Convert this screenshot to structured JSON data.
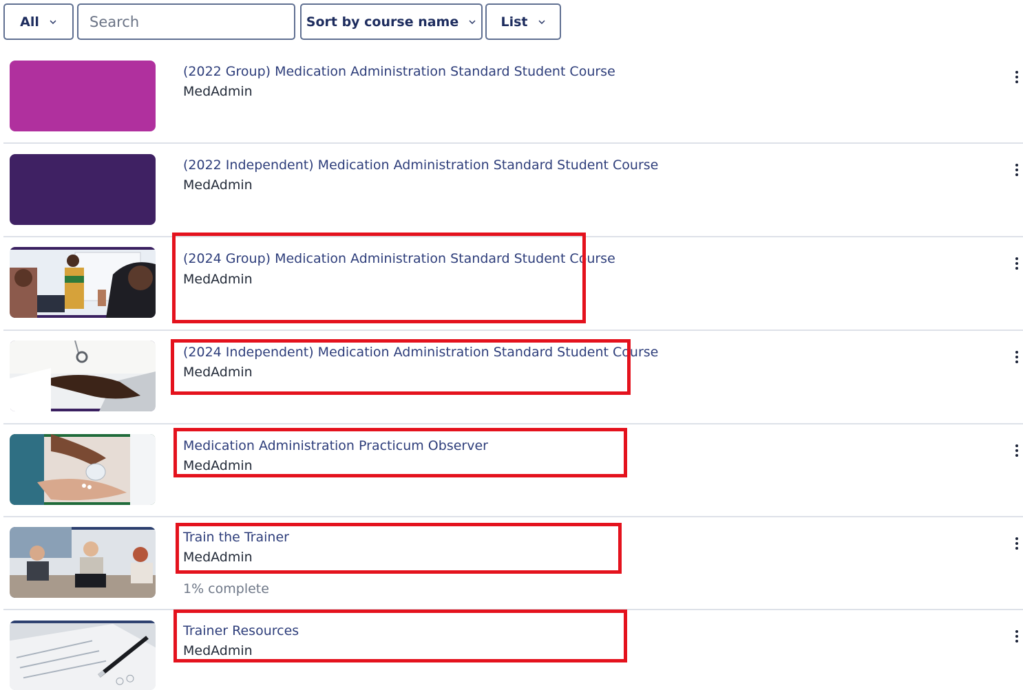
{
  "toolbar": {
    "filter_label": "All",
    "search_placeholder": "Search",
    "sort_label": "Sort by course name",
    "view_label": "List"
  },
  "courses": [
    {
      "title": "(2022 Group) Medication Administration Standard Student Course",
      "category": "MedAdmin",
      "thumbnail": "solid-magenta",
      "thumb_color": "#b0309e"
    },
    {
      "title": "(2022 Independent) Medication Administration Standard Student Course",
      "category": "MedAdmin",
      "thumbnail": "solid-purple",
      "thumb_color": "#3f2163"
    },
    {
      "title": "(2024 Group) Medication Administration Standard Student Course",
      "category": "MedAdmin",
      "thumbnail": "classroom-photo"
    },
    {
      "title": "(2024 Independent) Medication Administration Standard Student Course",
      "category": "MedAdmin",
      "thumbnail": "stethoscope-laptop-photo"
    },
    {
      "title": "Medication Administration Practicum Observer",
      "category": "MedAdmin",
      "thumbnail": "pills-in-hand-photo"
    },
    {
      "title": "Train the Trainer",
      "category": "MedAdmin",
      "thumbnail": "meeting-photo",
      "progress_text": "1% complete",
      "progress": 1
    },
    {
      "title": "Trainer Resources",
      "category": "MedAdmin",
      "thumbnail": "clipboard-pen-photo"
    }
  ],
  "highlight_color": "#e4121d"
}
